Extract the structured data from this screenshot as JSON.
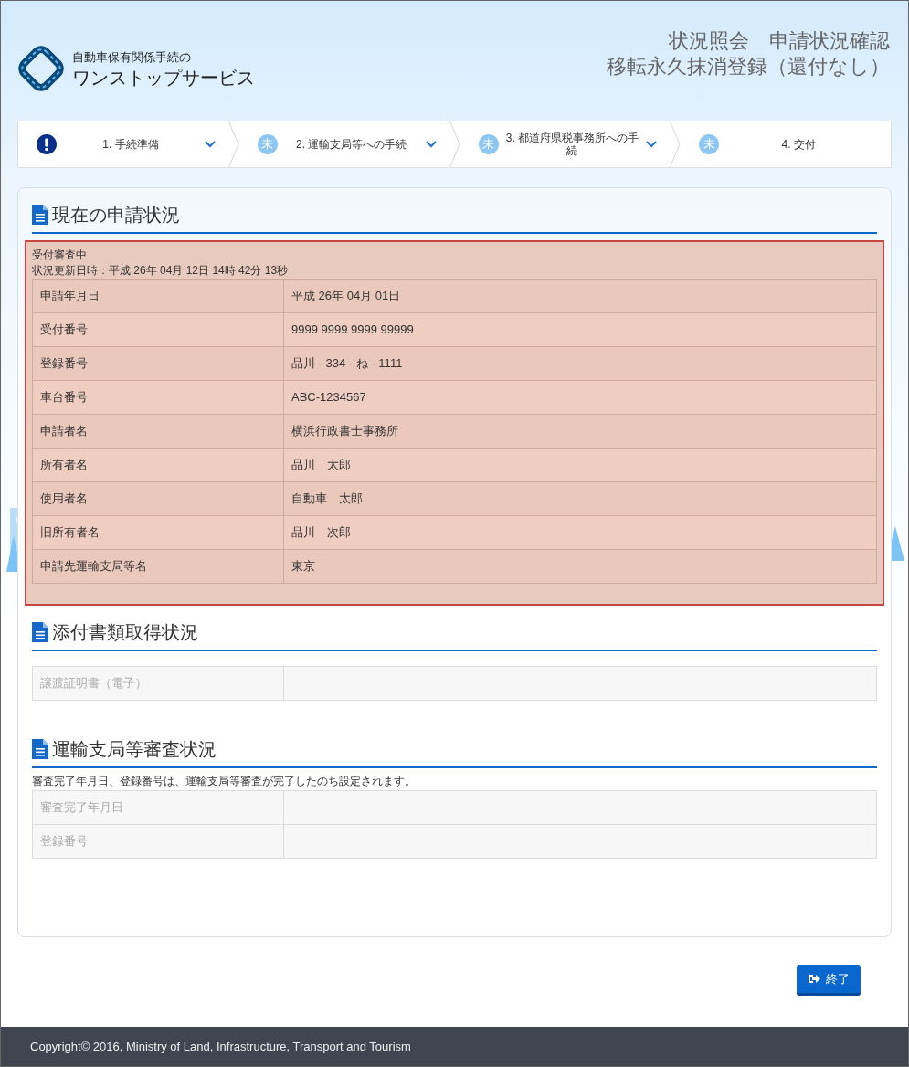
{
  "header": {
    "logo_line1": "自動車保有関係手続の",
    "logo_line2": "ワンストップサービス",
    "title_line1": "状況照会　申請状況確認",
    "title_line2": "移転永久抹消登録（還付なし）"
  },
  "steps": [
    {
      "kind": "alert",
      "label": "1. 手続準備"
    },
    {
      "kind": "pending",
      "badge": "未",
      "label": "2. 運輸支局等への手続"
    },
    {
      "kind": "pending",
      "badge": "未",
      "label": "3. 都道府県税事務所への手続"
    },
    {
      "kind": "pending",
      "badge": "未",
      "label": "4. 交付"
    }
  ],
  "sections": [
    {
      "title": "現在の申請状況",
      "highlighted": true,
      "status": "受付審査中",
      "updated": "状況更新日時：平成 26年 04月 12日 14時 42分 13秒",
      "rows": [
        {
          "label": "申請年月日",
          "value": "平成 26年 04月 01日",
          "disabled": false
        },
        {
          "label": "受付番号",
          "value": "9999 9999 9999 99999",
          "disabled": false
        },
        {
          "label": "登録番号",
          "value": "品川 - 334 - ね - 1111",
          "disabled": false
        },
        {
          "label": "車台番号",
          "value": "ABC-1234567",
          "disabled": false
        },
        {
          "label": "申請者名",
          "value": "横浜行政書士事務所",
          "disabled": false
        },
        {
          "label": "所有者名",
          "value": "品川　太郎",
          "disabled": false
        },
        {
          "label": "使用者名",
          "value": "自動車　太郎",
          "disabled": false
        },
        {
          "label": "旧所有者名",
          "value": "品川　次郎",
          "disabled": false
        },
        {
          "label": "申請先運輸支局等名",
          "value": "東京",
          "disabled": false
        }
      ]
    },
    {
      "title": "添付書類取得状況",
      "highlighted": false,
      "rows": [
        {
          "label": "譲渡証明書（電子）",
          "disabled": true
        }
      ]
    },
    {
      "title": "運輸支局等審査状況",
      "highlighted": false,
      "note": "審査完了年月日、登録番号は、運輸支局等審査が完了したのち設定されます。",
      "rows": [
        {
          "label": "審査完了年月日",
          "disabled": true
        },
        {
          "label": "登録番号",
          "disabled": true
        }
      ]
    }
  ],
  "button": "終了",
  "footer": "Copyright© 2016, Ministry of Land, Infrastructure, Transport and Tourism"
}
